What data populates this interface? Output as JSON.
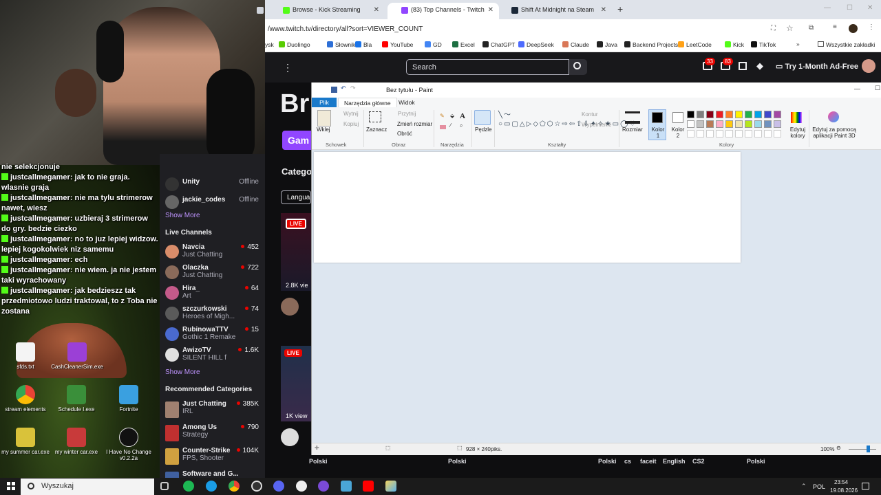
{
  "webcam": {},
  "chat": [
    {
      "user": "",
      "text": "nie selekcjonuje"
    },
    {
      "user": "justcallmegamer:",
      "text": " jak to nie graja. wlasnie graja"
    },
    {
      "user": "justcallmegamer:",
      "text": " nie ma tylu strimerow nawet, wiesz"
    },
    {
      "user": "justcallmegamer:",
      "text": " uzbieraj 3 strimerow do gry. bedzie ciezko"
    },
    {
      "user": "justcallmegamer:",
      "text": " no to juz lepiej widzow. lepiej kogokolwiek niz samemu"
    },
    {
      "user": "justcallmegamer:",
      "text": " ech"
    },
    {
      "user": "justcallmegamer:",
      "text": " nie wiem. ja nie jestem taki wyrachowany"
    },
    {
      "user": "justcallmegamer:",
      "text": " jak bedzieszz tak przedmiotowo ludzi traktowal, to z Toba nie zostana"
    }
  ],
  "desktop_icons": [
    {
      "label": "sfds.txt",
      "icon": "text-file-icon",
      "color": "#f4f4f4"
    },
    {
      "label": "CashCleanerSim.exe",
      "icon": "game-icon",
      "color": "#9b40d6"
    },
    {
      "label": "stream elements",
      "icon": "chrome-icon",
      "color": "#e8e8e8"
    },
    {
      "label": "Schedule I.exe",
      "icon": "game-icon",
      "color": "#3a8f3a"
    },
    {
      "label": "Fortnite",
      "icon": "fortnite-icon",
      "color": "#3aa0e0"
    },
    {
      "label": "my summer car.exe",
      "icon": "game-icon",
      "color": "#d9c23a"
    },
    {
      "label": "my winter car.exe",
      "icon": "game-icon",
      "color": "#c83a3a"
    },
    {
      "label": "I Have No Change v0.2.2a",
      "icon": "unreal-icon",
      "color": "#111111"
    }
  ],
  "browser": {
    "tabs": [
      {
        "title": "Browse - Kick Streaming",
        "icon": "kick-icon",
        "color": "#53fc18",
        "active": false
      },
      {
        "title": "(83) Top Channels - Twitch",
        "icon": "twitch-icon",
        "color": "#9146ff",
        "active": true
      },
      {
        "title": "Shift At Midnight na Steam",
        "icon": "steam-icon",
        "color": "#1b2838",
        "active": false
      }
    ],
    "new_tab": "+",
    "url": "/www.twitch.tv/directory/all?sort=VIEWER_COUNT",
    "bookmarks": [
      {
        "label": "ysk",
        "color": "#ffffff"
      },
      {
        "label": "Duolingo",
        "color": "#58cc02"
      },
      {
        "label": "Słownik",
        "color": "#2d6fd6"
      },
      {
        "label": "Bla",
        "color": "#1a73e8"
      },
      {
        "label": "YouTube",
        "color": "#ff0000"
      },
      {
        "label": "GD",
        "color": "#4285f4"
      },
      {
        "label": "Excel",
        "color": "#1d6f42"
      },
      {
        "label": "ChatGPT",
        "color": "#222222"
      },
      {
        "label": "DeepSeek",
        "color": "#4d6bfe"
      },
      {
        "label": "Claude",
        "color": "#d97757"
      },
      {
        "label": "Java",
        "color": "#222222"
      },
      {
        "label": "Backend Projects",
        "color": "#222222"
      },
      {
        "label": "LeetCode",
        "color": "#ffa116"
      },
      {
        "label": "Kick",
        "color": "#53fc18"
      },
      {
        "label": "TikTok",
        "color": "#111111"
      }
    ],
    "bookmarks_folder": "Wszystkie zakładki"
  },
  "twitch": {
    "search_placeholder": "Search",
    "notif1": "33",
    "notif2": "83",
    "ad_free": "Try 1-Month Ad-Free",
    "heading": "Br",
    "games_btn": "Gam",
    "categories": "Catego",
    "language": "Langua",
    "live_badge": "LIVE",
    "viewers1": "2.8K vie",
    "viewers2": "1K view",
    "followed": [
      {
        "name": "Unity",
        "status": "Offline",
        "color": "#333"
      },
      {
        "name": "jackie_codes",
        "status": "Offline",
        "color": "#666"
      }
    ],
    "show_more": "Show More",
    "live_channels_title": "Live Channels",
    "live": [
      {
        "name": "Navcia",
        "game": "Just Chatting",
        "viewers": "452",
        "color": "#d98c6a"
      },
      {
        "name": "Olaczka",
        "game": "Just Chatting",
        "viewers": "722",
        "color": "#8a6a5a"
      },
      {
        "name": "Hira_",
        "game": "Art",
        "viewers": "64",
        "color": "#c45a8a"
      },
      {
        "name": "szczurkowski",
        "game": "Heroes of Migh...",
        "viewers": "74",
        "color": "#5a5a5a"
      },
      {
        "name": "RubinowaTTV",
        "game": "Gothic 1 Remake",
        "viewers": "15",
        "color": "#4a6ad0"
      },
      {
        "name": "AwizoTV",
        "game": "SILENT HILL f",
        "viewers": "1.6K",
        "color": "#e0e0e0"
      }
    ],
    "show_more2": "Show More",
    "recommended_title": "Recommended Categories",
    "recommended": [
      {
        "name": "Just Chatting",
        "game": "IRL",
        "viewers": "385K",
        "color": "#a08070"
      },
      {
        "name": "Among Us",
        "game": "Strategy",
        "viewers": "790",
        "color": "#c03030"
      },
      {
        "name": "Counter-Strike",
        "game": "FPS, Shooter",
        "viewers": "104K",
        "color": "#d0a040"
      },
      {
        "name": "Software and G...",
        "game": "",
        "viewers": "",
        "color": "#4060a0"
      }
    ],
    "lang_tags": [
      "Polski",
      "Polski",
      "Polski",
      "cs",
      "faceit",
      "English",
      "CS2",
      "Polski"
    ]
  },
  "paint": {
    "title": "Bez tytułu - Paint",
    "tab_file": "Plik",
    "tab_home": "Narzędzia główne",
    "tab_view": "Widok",
    "paste": "Wklej",
    "cut": "Wytnij",
    "copy": "Kopiuj",
    "group_clipboard": "Schowek",
    "select": "Zaznacz",
    "crop": "Przytnij",
    "resize": "Zmień rozmiar",
    "rotate": "Obróć",
    "group_image": "Obraz",
    "group_tools": "Narzędzia",
    "brushes": "Pędzle",
    "outline": "Kontur",
    "fill": "Wypełnienie",
    "group_shapes": "Kształty",
    "size": "Rozmiar",
    "color1": "Kolor 1",
    "color2": "Kolor 2",
    "edit_colors": "Edytuj kolory",
    "group_colors": "Kolory",
    "paint3d": "Edytuj za pomocą aplikacji Paint 3D",
    "palette": [
      "#000000",
      "#7f7f7f",
      "#880015",
      "#ed1c24",
      "#ff7f27",
      "#fff200",
      "#22b14c",
      "#00a2e8",
      "#3f48cc",
      "#a349a4",
      "#ffffff",
      "#c3c3c3",
      "#b97a57",
      "#ffaec9",
      "#ffc90e",
      "#efe4b0",
      "#b5e61d",
      "#99d9ea",
      "#7092be",
      "#c8bfe7"
    ],
    "dimensions": "928 × 240piks.",
    "zoom": "100%"
  },
  "taskbar": {
    "search": "Wyszukaj",
    "lang": "POL",
    "time": "23:54",
    "date": "19.08.2026"
  }
}
